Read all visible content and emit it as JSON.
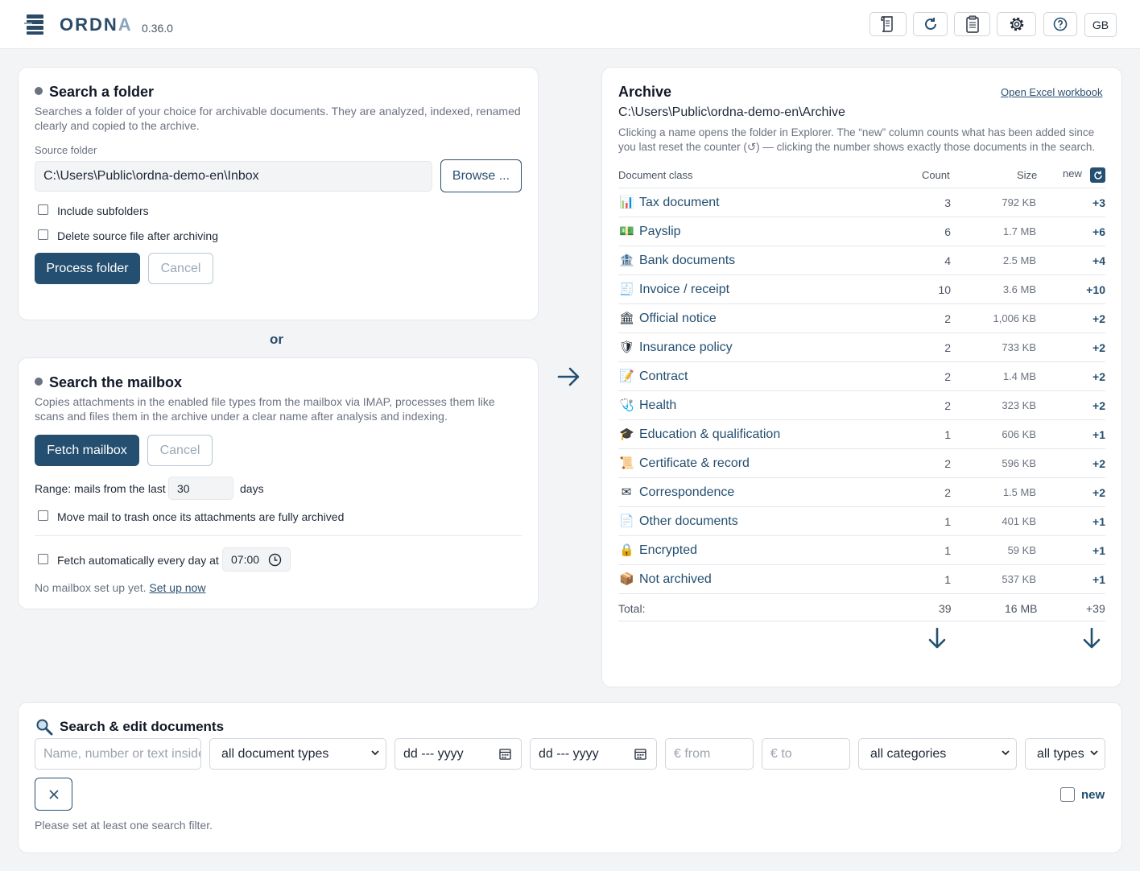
{
  "app": {
    "name_main": "ORDN",
    "name_last": "A",
    "version": "0.36.0",
    "lang": "GB"
  },
  "header_buttons": [
    "scroll-icon",
    "refresh-icon",
    "clipboard-icon",
    "gear-icon",
    "help-icon"
  ],
  "folder": {
    "title": "Search a folder",
    "desc": "Searches a folder of your choice for archivable documents. They are analyzed, indexed, renamed clearly and copied to the archive.",
    "source_label": "Source folder",
    "source_value": "C:\\Users\\Public\\ordna-demo-en\\Inbox",
    "browse": "Browse ...",
    "include_sub": "Include subfolders",
    "delete_source": "Delete source file after archiving",
    "process": "Process folder",
    "cancel": "Cancel"
  },
  "or": "or",
  "mailbox": {
    "title": "Search the mailbox",
    "desc": "Copies attachments in the enabled file types from the mailbox via IMAP, processes them like scans and files them in the archive under a clear name after analysis and indexing.",
    "fetch": "Fetch mailbox",
    "cancel": "Cancel",
    "range_prefix": "Range: mails from the last",
    "range_value": "30",
    "range_suffix": "days",
    "move_trash": "Move mail to trash once its attachments are fully archived",
    "auto_fetch": "Fetch automatically every day at",
    "auto_time": "07:00",
    "no_mailbox": "No mailbox set up yet.",
    "setup_link": "Set up now"
  },
  "archive": {
    "title": "Archive",
    "open_excel": "Open Excel workbook",
    "path": "C:\\Users\\Public\\ordna-demo-en\\Archive",
    "desc": "Clicking a name opens the folder in Explorer. The “new” column counts what has been added since you last reset the counter (↺) — clicking the number shows exactly those documents in the search.",
    "col_class": "Document class",
    "col_count": "Count",
    "col_size": "Size",
    "col_new": "new",
    "rows": [
      {
        "icon": "📊",
        "name": "Tax document",
        "count": "3",
        "size": "792 KB",
        "new": "+3"
      },
      {
        "icon": "💵",
        "name": "Payslip",
        "count": "6",
        "size": "1.7 MB",
        "new": "+6"
      },
      {
        "icon": "🏦",
        "name": "Bank documents",
        "count": "4",
        "size": "2.5 MB",
        "new": "+4"
      },
      {
        "icon": "🧾",
        "name": "Invoice / receipt",
        "count": "10",
        "size": "3.6 MB",
        "new": "+10"
      },
      {
        "icon": "🏛",
        "name": "Official notice",
        "count": "2",
        "size": "1,006 KB",
        "new": "+2"
      },
      {
        "icon": "🛡",
        "name": "Insurance policy",
        "count": "2",
        "size": "733 KB",
        "new": "+2"
      },
      {
        "icon": "📝",
        "name": "Contract",
        "count": "2",
        "size": "1.4 MB",
        "new": "+2"
      },
      {
        "icon": "🩺",
        "name": "Health",
        "count": "2",
        "size": "323 KB",
        "new": "+2"
      },
      {
        "icon": "🎓",
        "name": "Education & qualification",
        "count": "1",
        "size": "606 KB",
        "new": "+1"
      },
      {
        "icon": "📜",
        "name": "Certificate & record",
        "count": "2",
        "size": "596 KB",
        "new": "+2"
      },
      {
        "icon": "✉",
        "name": "Correspondence",
        "count": "2",
        "size": "1.5 MB",
        "new": "+2"
      },
      {
        "icon": "📄",
        "name": "Other documents",
        "count": "1",
        "size": "401 KB",
        "new": "+1"
      },
      {
        "icon": "🔒",
        "name": "Encrypted",
        "count": "1",
        "size": "59 KB",
        "new": "+1"
      },
      {
        "icon": "📦",
        "name": "Not archived",
        "count": "1",
        "size": "537 KB",
        "new": "+1"
      }
    ],
    "total_label": "Total:",
    "total_count": "39",
    "total_size": "16 MB",
    "total_new": "+39"
  },
  "search": {
    "title": "Search & edit documents",
    "name_placeholder": "Name, number or text inside",
    "doc_types": "all document types",
    "date_from": "dd --- yyyy",
    "date_to": "dd --- yyyy",
    "amount_from": "€ from",
    "amount_to": "€ to",
    "categories": "all categories",
    "types": "all types",
    "new_label": "new",
    "hint": "Please set at least one search filter."
  }
}
